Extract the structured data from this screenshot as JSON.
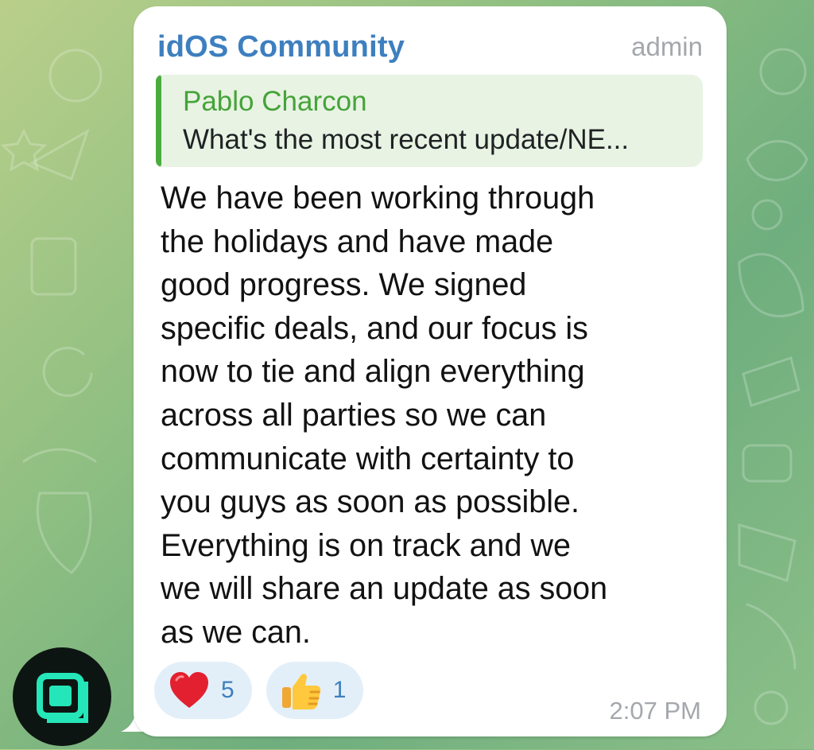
{
  "message": {
    "sender": "idOS Community",
    "sender_role": "admin",
    "reply": {
      "author": "Pablo Charcon",
      "preview": "What's the most recent update/NE..."
    },
    "text": "We have been working through\nthe holidays and have made\ngood progress. We signed\nspecific deals, and our focus is\nnow to tie and align everything\nacross all parties so we can\ncommunicate with certainty to\nyou guys as soon as possible.\nEverything is on track and we\nwe will share an update as soon\nas we can.",
    "reactions": [
      {
        "icon": "red-heart-icon",
        "count": "5"
      },
      {
        "icon": "thumbs-up-icon",
        "count": "1"
      }
    ],
    "time": "2:07 PM"
  },
  "avatar": {
    "icon": "idos-logo-icon",
    "accent_color": "#25e6b8"
  },
  "colors": {
    "sender": "#3d7fbf",
    "reply_author": "#45a339",
    "reply_bar": "#4aac3e",
    "reply_background": "#e8f3e3",
    "reaction_background": "#e3eff8"
  }
}
